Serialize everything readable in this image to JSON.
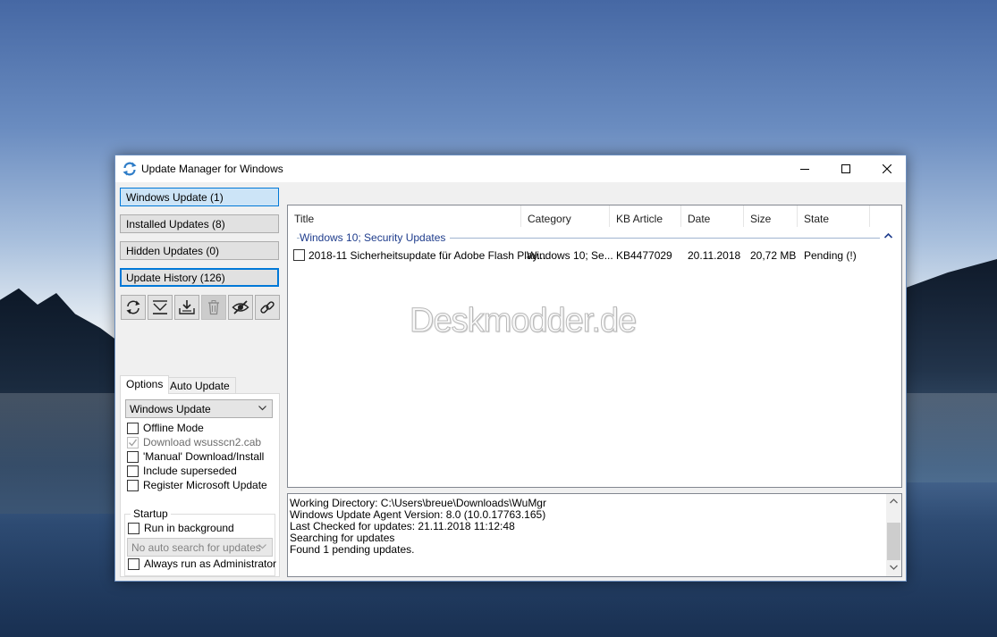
{
  "window": {
    "title": "Update Manager for Windows",
    "accent_color": "#0078d7"
  },
  "sidebar": {
    "nav": [
      {
        "label": "Windows Update (1)"
      },
      {
        "label": "Installed Updates (8)"
      },
      {
        "label": "Hidden Updates (0)"
      },
      {
        "label": "Update History (126)"
      }
    ],
    "toolbar_icons": [
      "refresh-icon",
      "download-icon",
      "install-icon",
      "delete-icon",
      "hide-icon",
      "link-icon"
    ]
  },
  "tabs": {
    "options_label": "Options",
    "auto_update_label": "Auto Update"
  },
  "options": {
    "source_selected": "Windows Update",
    "checkboxes": [
      {
        "label": "Offline Mode",
        "checked": false,
        "enabled": true
      },
      {
        "label": "Download wsusscn2.cab",
        "checked": true,
        "enabled": false
      },
      {
        "label": "'Manual' Download/Install",
        "checked": false,
        "enabled": true
      },
      {
        "label": "Include superseded",
        "checked": false,
        "enabled": true
      },
      {
        "label": "Register Microsoft Update",
        "checked": false,
        "enabled": true
      }
    ],
    "startup": {
      "legend": "Startup",
      "run_in_background": "Run in background",
      "auto_search_selected": "No auto search for updates",
      "always_admin": "Always run as Administrator"
    }
  },
  "list": {
    "columns": [
      "Title",
      "Category",
      "KB Article",
      "Date",
      "Size",
      "State"
    ],
    "group_title": "Windows 10; Security Updates",
    "rows": [
      {
        "title": "2018-11 Sicherheitsupdate für Adobe Flash Play...",
        "category": "Windows 10; Se...",
        "kb": "KB4477029",
        "date": "20.11.2018",
        "size": "20,72 MB",
        "state": "Pending (!)"
      }
    ]
  },
  "watermark": "Deskmodder.de",
  "log": [
    "Working Directory: C:\\Users\\breue\\Downloads\\WuMgr",
    "Windows Update Agent Version: 8.0 (10.0.17763.165)",
    "Last Checked for updates: 21.11.2018 11:12:48",
    "Searching for updates",
    "Found 1 pending updates."
  ]
}
